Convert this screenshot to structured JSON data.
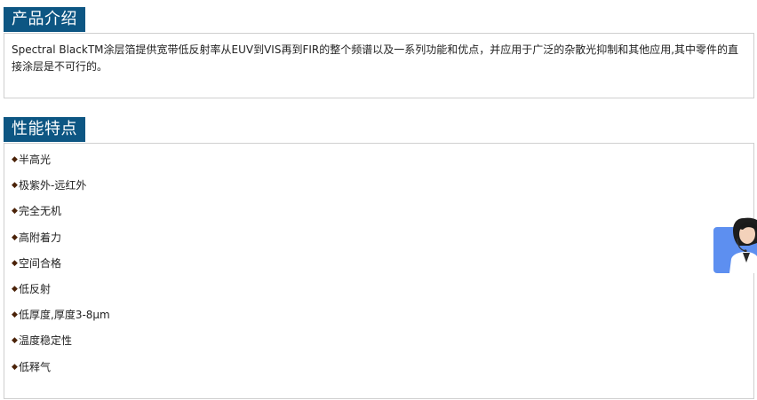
{
  "intro": {
    "title": "产品介绍",
    "text": "Spectral BlackTM涂层箔提供宽带低反射率从EUV到VIS再到FIR的整个频谱以及一系列功能和优点，并应用于广泛的杂散光抑制和其他应用,其中零件的直接涂层是不可行的。"
  },
  "features": {
    "title": "性能特点",
    "items": [
      {
        "label": "半高光"
      },
      {
        "label": "极紫外-远红外"
      },
      {
        "label": "完全无机"
      },
      {
        "label": "高附着力"
      },
      {
        "label": "空间合格"
      },
      {
        "label": "低反射"
      },
      {
        "label": "低厚度,厚度3-8μm"
      },
      {
        "label": "温度稳定性"
      },
      {
        "label": "低释气"
      }
    ]
  },
  "support_widget": {
    "icon": "customer-service-icon"
  },
  "colors": {
    "tab_bg": "#0d5683",
    "border": "#cfcfcf",
    "support_bg": "#5d8ff0"
  }
}
